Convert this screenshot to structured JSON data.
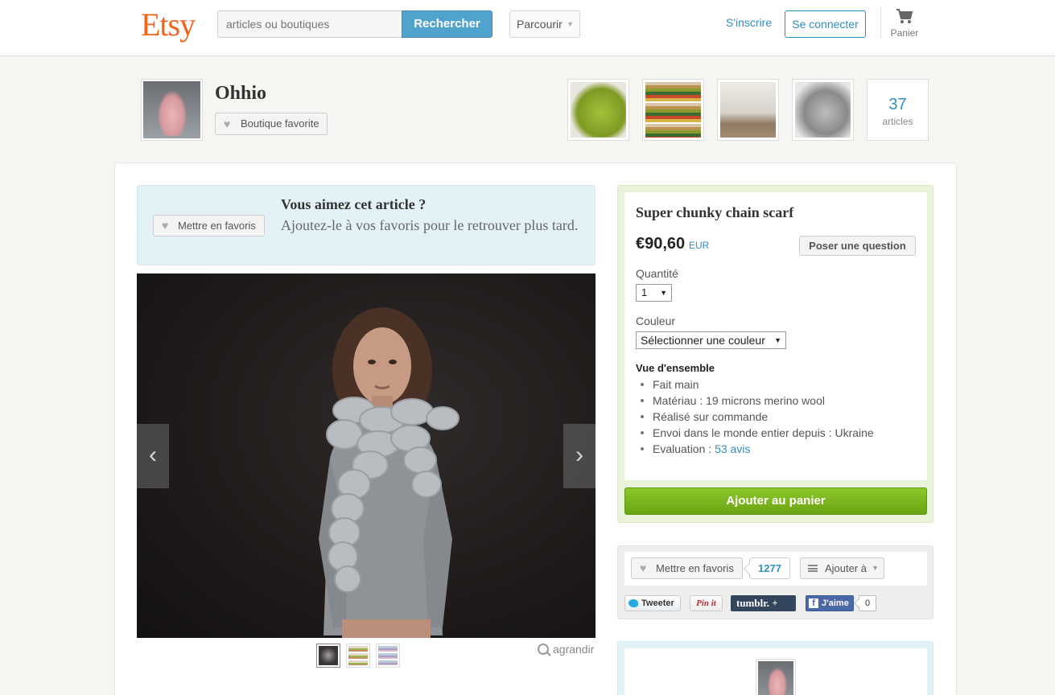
{
  "header": {
    "logo": "Etsy",
    "search_placeholder": "articles ou boutiques",
    "search_button": "Rechercher",
    "browse_label": "Parcourir",
    "signup_label": "S'inscrire",
    "signin_label": "Se connecter",
    "cart_label": "Panier"
  },
  "shop": {
    "name": "Ohhio",
    "favorite_shop_label": "Boutique favorite",
    "items_count": "37",
    "items_label": "articles"
  },
  "favorite_banner": {
    "button_label": "Mettre en favoris",
    "title": "Vous aimez cet article ?",
    "text": "Ajoutez-le à vos favoris pour le retrouver plus tard."
  },
  "gallery": {
    "prev_glyph": "‹",
    "next_glyph": "›",
    "zoom_label": "agrandir"
  },
  "listing": {
    "title": "Super chunky chain scarf",
    "price": "€90,60",
    "currency": "EUR",
    "ask_question_label": "Poser une question",
    "quantity_label": "Quantité",
    "quantity_value": "1",
    "color_label": "Couleur",
    "color_value": "Sélectionner une couleur",
    "overview_title": "Vue d'ensemble",
    "overview": {
      "handmade": "Fait main",
      "material": "Matériau : 19 microns merino wool",
      "made_to_order": "Réalisé sur commande",
      "ships_from": "Envoi dans le monde entier depuis : Ukraine",
      "rating_prefix": "Evaluation : ",
      "rating_link": "53 avis"
    },
    "add_to_cart_label": "Ajouter au panier"
  },
  "social": {
    "favorite_label": "Mettre en favoris",
    "favorite_count": "1277",
    "add_to_label": "Ajouter à",
    "tweet_label": "Tweeter",
    "pinit_label": "Pin it",
    "tumblr_label": "tumblr. +",
    "fb_like_label": "J'aime",
    "fb_count": "0"
  },
  "colors": {
    "brand": "#f1641e",
    "link": "#2f8fc0",
    "search_button": "#4fa3cd",
    "add_to_cart": "#7cb51e"
  },
  "icons": {
    "cart": "cart-icon",
    "heart": "heart-icon",
    "zoom": "magnifier-icon"
  }
}
